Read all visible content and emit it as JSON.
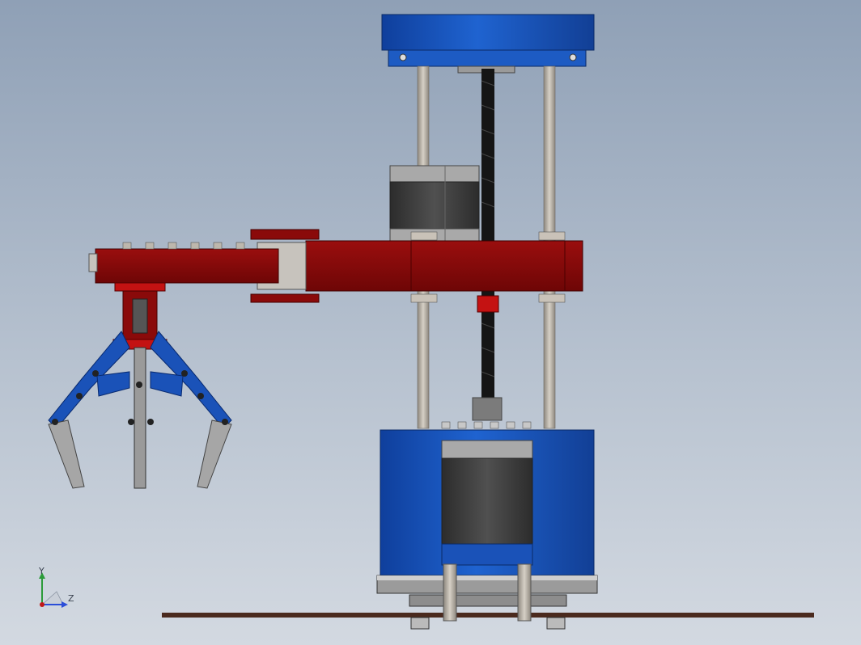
{
  "viewport": {
    "background_top": "#8fa0b6",
    "background_bottom": "#d3d9e1"
  },
  "model": {
    "parts": [
      "top-cap",
      "guide-rod-left",
      "guide-rod-right",
      "lead-screw",
      "stepper-motor-upper",
      "arm-carriage",
      "arm-link",
      "gripper",
      "base-housing",
      "stepper-motor-base",
      "base-gear",
      "ground-plane"
    ],
    "colors": {
      "blue": "#1a52b8",
      "red": "#8a0a0a",
      "steel": "#b9b3aa",
      "motor": "#3a3a3a",
      "floor": "#4a2a1e"
    }
  },
  "triad": {
    "y_label": "Y",
    "z_label": "Z",
    "y_color": "#2c9b3a",
    "z_color": "#2b4ed8",
    "origin_color": "#c01818"
  }
}
